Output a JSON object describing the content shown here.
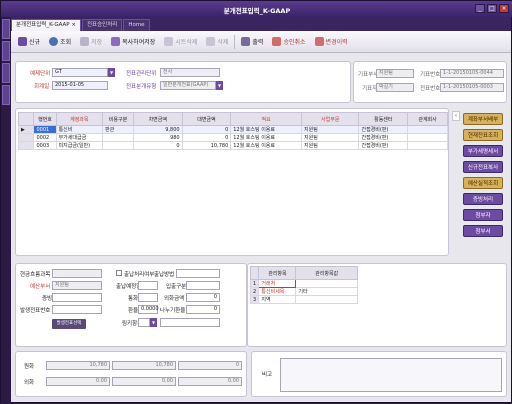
{
  "window": {
    "title": "분개전표입력_K-GAAP",
    "controls": [
      "_",
      "□",
      "×"
    ]
  },
  "tabs": [
    {
      "label": "분개전표입력_K-GAAP",
      "close": "×"
    },
    {
      "label": "전표승인처리"
    },
    {
      "label": "Home"
    }
  ],
  "toolbar": {
    "new_label": "신규",
    "search_label": "조회",
    "save_label": "저장",
    "copy_label": "복사하여저장",
    "sheet_delete_label": "시트삭제",
    "delete_label": "삭제",
    "print_label": "출력",
    "approve_label": "승인취소",
    "history_label": "변경이력"
  },
  "header": {
    "voucher_type_label": "예제단위",
    "voucher_type_value": "GT",
    "date_label": "회계일",
    "date_value": "2015-01-05",
    "entry_unit_label": "전표관리단위",
    "entry_unit_value": "전사",
    "ledger_label": "전표분개유형",
    "ledger_value": "일반분개전표(GAAP)",
    "writer_label": "기표부서",
    "writer_value": "지원팀",
    "writer2_label": "기표자",
    "writer2_value": "박길기",
    "voucher_no_label": "기표번호",
    "voucher_no_value": "1-1-20150105-0044",
    "voucher_no2_label": "전표번호",
    "voucher_no2_value": "1-1-20150105-0003"
  },
  "grid": {
    "columns": [
      "행번호",
      "계정과목",
      "비용구분",
      "차변금액",
      "대변금액",
      "적요",
      "사업부문",
      "활동센터",
      "관계회사"
    ],
    "rows": [
      {
        "no": "0001",
        "account": "통신비",
        "cost": "판관",
        "debit": "9,800",
        "credit": "0",
        "memo": "12월 호스팅 이용료",
        "dept": "지원팀",
        "center": "간접경비(판)",
        "rel": ""
      },
      {
        "no": "0002",
        "account": "부가세대급금",
        "cost": "",
        "debit": "980",
        "credit": "0",
        "memo": "12월 호스팅 이용료",
        "dept": "지원팀",
        "center": "간접경비(판)",
        "rel": ""
      },
      {
        "no": "0003",
        "account": "미지급금(일반)",
        "cost": "",
        "debit": "0",
        "credit": "10,780",
        "memo": "12월 호스팅 이용료",
        "dept": "지원팀",
        "center": "간접경비(판)",
        "rel": ""
      }
    ]
  },
  "side_buttons": [
    "계좌부서배부",
    "현재전표조회",
    "부가세명세서",
    "신규전표복사",
    "예산실적조회",
    "증빙처리",
    "첨부자",
    "첨부서"
  ],
  "detail": {
    "account_label": "현금흐름과목",
    "dept_label": "예산부서",
    "dept_value": "지원팀",
    "evidence_label": "증빙",
    "currency_label": "통화",
    "rate_label": "환율",
    "rate_value": "0.0000",
    "foreign_label": "외화금액",
    "foreign_value": "0",
    "fx_label": "나누기환율",
    "fx_value": "0",
    "budget_label": "발생전표번호",
    "check_label": "출납처리여부",
    "method_label": "출납방법",
    "section_label": "입출구분",
    "period_label": "출납예정일",
    "time_label": "합계",
    "button_label": "발생전표선택",
    "manage_label": "링키항목"
  },
  "mgmt": {
    "columns": [
      "관리항목",
      "관리항목값"
    ],
    "rows": [
      {
        "no": "1",
        "item": "거래처",
        "value": ""
      },
      {
        "no": "2",
        "item": "통신비세목",
        "value": "기타"
      },
      {
        "no": "3",
        "item": "지역",
        "value": ""
      }
    ]
  },
  "totals": {
    "won_label": "원화",
    "won_debit": "10,780",
    "won_credit": "10,780",
    "won_diff": "0",
    "fx_label": "외화",
    "fx_debit": "0.00",
    "fx_credit": "0.00",
    "fx_diff": "0.00",
    "memo_label": "비고"
  },
  "colors": {
    "accent": "#6b4ca0",
    "gold": "#d7b25a",
    "title_bg": "#3a2466"
  }
}
